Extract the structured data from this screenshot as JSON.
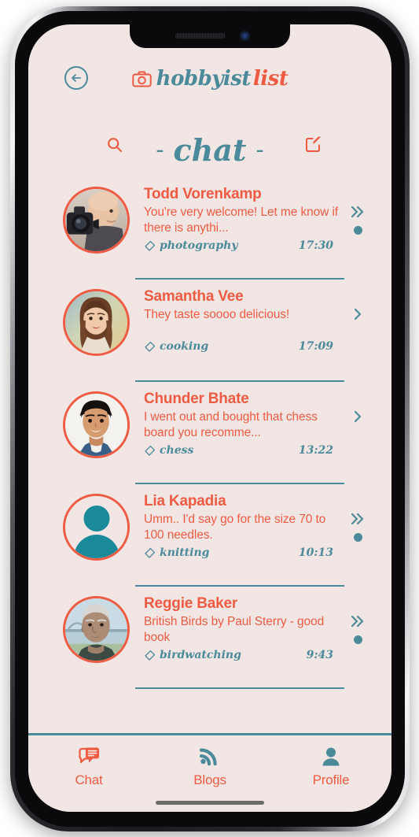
{
  "device": {
    "notch_speaker": "speaker-grille",
    "notch_camera": "front-camera",
    "home_indicator": "home-indicator"
  },
  "colors": {
    "accent_orange": "#ef5b42",
    "accent_teal": "#4a8a9b",
    "avatar_teal": "#1a8a9b",
    "background": "#f1e6e3"
  },
  "header": {
    "back_icon": "back-arrow-circle-icon",
    "logo_icon": "camera-icon",
    "brand_part_1": "hobbyist",
    "brand_part_2": "list"
  },
  "title_bar": {
    "search_icon": "search-icon",
    "compose_icon": "compose-edit-icon",
    "dash_left": "-",
    "title": "chat",
    "dash_right": "-"
  },
  "chats": [
    {
      "name": "Todd Vorenkamp",
      "preview": "You're very welcome! Let me know if there is anythi...",
      "tag": "photography",
      "tag_icon": "tag-icon",
      "time": "17:30",
      "chevron": "double-chevron-right-icon",
      "unread": true,
      "avatar": "photo"
    },
    {
      "name": "Samantha Vee",
      "preview": "They taste soooo delicious!",
      "tag": "cooking",
      "tag_icon": "tag-icon",
      "time": "17:09",
      "chevron": "chevron-right-icon",
      "unread": false,
      "avatar": "photo"
    },
    {
      "name": "Chunder Bhate",
      "preview": "I went out and bought that chess board you recomme...",
      "tag": "chess",
      "tag_icon": "tag-icon",
      "time": "13:22",
      "chevron": "chevron-right-icon",
      "unread": false,
      "avatar": "photo"
    },
    {
      "name": "Lia Kapadia",
      "preview": "Umm.. I'd say go for the size 70 to 100 needles.",
      "tag": "knitting",
      "tag_icon": "tag-icon",
      "time": "10:13",
      "chevron": "double-chevron-right-icon",
      "unread": true,
      "avatar": "placeholder"
    },
    {
      "name": "Reggie Baker",
      "preview": "British Birds by Paul Sterry - good book",
      "tag": "birdwatching",
      "tag_icon": "tag-icon",
      "time": "9:43",
      "chevron": "double-chevron-right-icon",
      "unread": true,
      "avatar": "photo"
    }
  ],
  "bottom_nav": [
    {
      "label": "Chat",
      "icon": "chat-bubbles-icon",
      "active": true
    },
    {
      "label": "Blogs",
      "icon": "rss-feed-icon",
      "active": false
    },
    {
      "label": "Profile",
      "icon": "person-icon",
      "active": false
    }
  ]
}
